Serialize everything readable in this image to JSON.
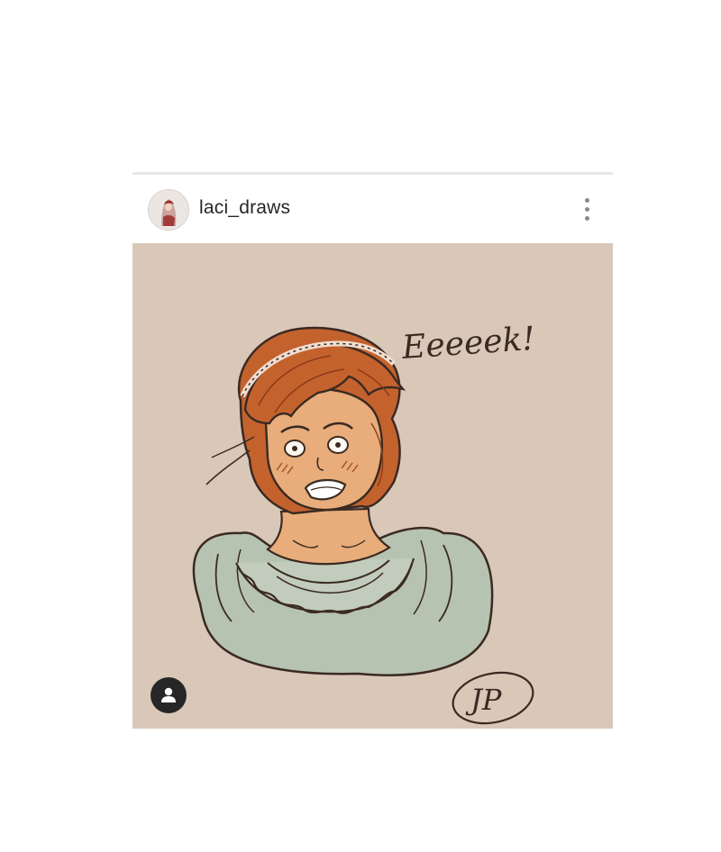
{
  "post": {
    "username": "laci_draws",
    "avatar_icon": "user-avatar-thumbnail",
    "more_icon": "more-vertical-icon",
    "tag_icon": "person-tag-icon"
  },
  "artwork": {
    "exclamation_text": "Eeeeek!",
    "signature_text": "JP",
    "colors": {
      "paper": "#dccbbd",
      "hair": "#c4622e",
      "skin": "#e8ad7a",
      "dress": "#b7c3b1",
      "ink": "#3a2a22"
    }
  }
}
